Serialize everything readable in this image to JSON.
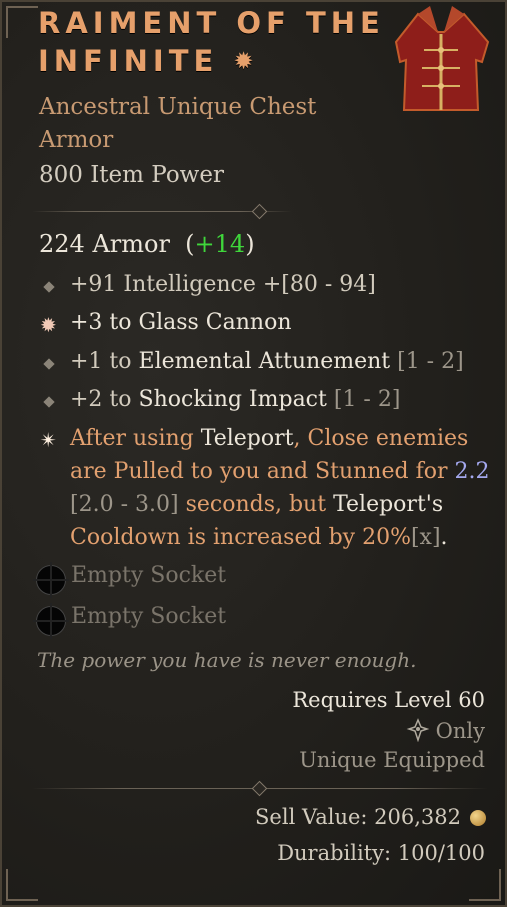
{
  "item": {
    "title_line1": "RAIMENT OF THE",
    "title_line2": "INFINITE",
    "title_icon": "unique-star-icon",
    "subtitle_line1": "Ancestral Unique Chest",
    "subtitle_line2": "Armor",
    "item_power": "800 Item Power",
    "image": "chest-armor-icon"
  },
  "armor": {
    "value": "224 Armor",
    "bonus": "+14"
  },
  "affixes": [
    {
      "icon": "diamond-bullet-icon",
      "text": "+91 Intelligence",
      "range": "+[80 - 94]"
    },
    {
      "icon": "unique-star-icon",
      "text": "+3 to Glass Cannon"
    },
    {
      "icon": "diamond-bullet-icon",
      "prefix": "+1 to",
      "skill": "Elemental Attunement",
      "range": "[1 - 2]"
    },
    {
      "icon": "diamond-bullet-icon",
      "prefix": "+2 to",
      "skill": "Shocking Impact",
      "range": "[1 - 2]"
    }
  ],
  "unique_power": {
    "icon": "unique-sparkle-icon",
    "p1": "After using",
    "p2": "Teleport",
    "p3": ", Close enemies",
    "p4": "are Pulled to you and Stunned for",
    "p5": "2.2",
    "p6": "[2.0 - 3.0]",
    "p7": "seconds, but",
    "p8": "Teleport's",
    "p9": "Cooldown is increased by 20%",
    "p10": "[x]",
    "p11": "."
  },
  "sockets": [
    {
      "icon": "empty-socket-icon",
      "label": "Empty Socket"
    },
    {
      "icon": "empty-socket-icon",
      "label": "Empty Socket"
    }
  ],
  "flavor_text": "The power you have is never enough.",
  "requirements": {
    "level": "Requires Level 60",
    "class_icon": "sorcerer-class-icon",
    "class_only": "Only",
    "unique_equipped": "Unique Equipped"
  },
  "footer": {
    "sell_value": "Sell Value: 206,382",
    "gold_icon": "gold-coin-icon",
    "durability": "Durability: 100/100"
  },
  "colors": {
    "title": "#e6a06b",
    "unique_power": "#e2a06f",
    "bonus_green": "#3fd63b",
    "value_blue": "#a4a8ee"
  }
}
